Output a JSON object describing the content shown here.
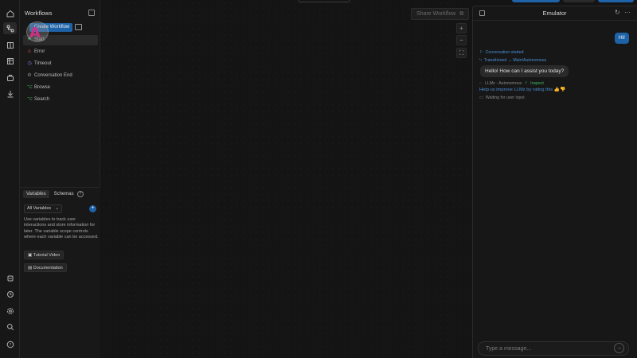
{
  "rail": {
    "icons": [
      "home-icon",
      "workflows-icon",
      "book-icon",
      "table-icon",
      "package-icon",
      "deploy-icon",
      "agents-icon",
      "history-icon",
      "settings-icon",
      "search-icon",
      "help-icon"
    ]
  },
  "workflows_panel": {
    "title": "Workflows",
    "create_label": "Create Workflow",
    "cursor_letter": "A",
    "items": [
      {
        "label": "Start",
        "glyph": "⚑",
        "color": "#3fbf6a"
      },
      {
        "label": "Error",
        "glyph": "⚠",
        "color": "#e0554f"
      },
      {
        "label": "Timeout",
        "glyph": "◷",
        "color": "#8a7de0"
      },
      {
        "label": "Conversation End",
        "glyph": "⚙",
        "color": "#8a8a8a"
      },
      {
        "label": "Browse",
        "glyph": "⌥",
        "color": "#3fbf6a"
      },
      {
        "label": "Search",
        "glyph": "⌥",
        "color": "#3fbf6a"
      }
    ]
  },
  "variables": {
    "tab_variables": "Variables",
    "tab_schemas": "Schemas",
    "help_glyph": "?",
    "filter_value": "All Variables",
    "add_glyph": "+",
    "description": "Use variables to track user interactions and store information for later. The variable scope controls where each variable can be accessed.",
    "tutorial_label": "Tutorial Video",
    "docs_label": "Documentation"
  },
  "canvas": {
    "share_label": "Share Workflow",
    "zoom_in": "+",
    "zoom_out": "−",
    "fit": "⛶"
  },
  "emulator": {
    "title": "Emulator",
    "user_message": "Hi!",
    "conversation_started": "Conversation started",
    "transitioned": "Transitioned → Main/Autonomous",
    "bot_message": "Hello! How can I assist you today?",
    "llm_label": "LLMz - Autonomous",
    "inspect_label": "Inspect",
    "help_improve": "Help us improve LLMz by rating this 👍👎",
    "waiting": "Waiting for user input",
    "input_placeholder": "Type a message..."
  },
  "colors": {
    "accent": "#1e62a8",
    "link": "#4a8fd6",
    "success": "#3fbf6a"
  }
}
